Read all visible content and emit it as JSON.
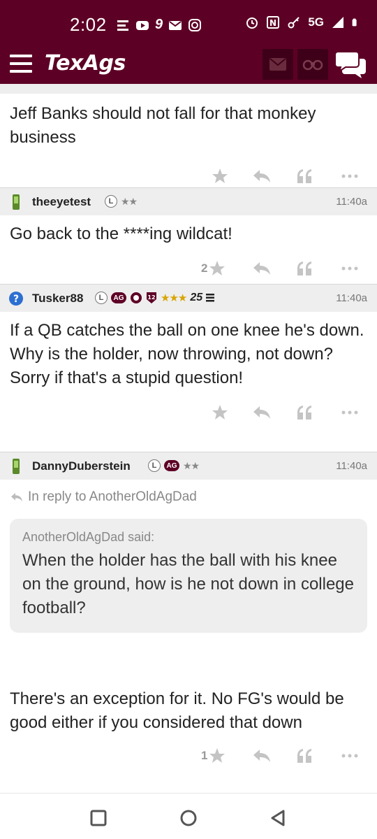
{
  "status_bar": {
    "time": "2:02",
    "network": "5G",
    "left_icons": [
      "notification-icon",
      "youtube-icon",
      "nine-icon",
      "mail-icon",
      "instagram-icon"
    ],
    "right_icons": [
      "alarm-icon",
      "nfc-icon",
      "key-icon",
      "signal-icon",
      "battery-icon"
    ]
  },
  "header": {
    "brand": "TexAgs",
    "colors": {
      "maroon": "#5d0025",
      "maroon_dark": "#3e0018"
    }
  },
  "posts": [
    {
      "username": "",
      "badges": [],
      "time": "",
      "body": "Jeff Banks should not fall for that monkey business",
      "like_count": ""
    },
    {
      "username": "theeyetest",
      "badges": [
        "L"
      ],
      "stars": "★★",
      "time": "11:40a",
      "body": "Go back to the ****ing wildcat!",
      "like_count": "2"
    },
    {
      "username": "Tusker88",
      "badges": [
        "L",
        "AG",
        "12"
      ],
      "stars": "★★★",
      "rank": "25",
      "time": "11:40a",
      "body": "If a QB catches the ball on one knee he's down. Why is the holder, now throwing, not down? Sorry if that's a stupid question!",
      "like_count": ""
    },
    {
      "username": "DannyDuberstein",
      "badges": [
        "L",
        "AG"
      ],
      "stars": "★★",
      "time": "11:40a",
      "reply_to": "In reply to AnotherOldAgDad",
      "quote_author": "AnotherOldAgDad said:",
      "quote_text": "When the holder has the ball with his knee on the ground, how is he not down in college football?",
      "body": "There's an exception for it. No FG's would be good either if you considered that down",
      "like_count": "1"
    }
  ]
}
